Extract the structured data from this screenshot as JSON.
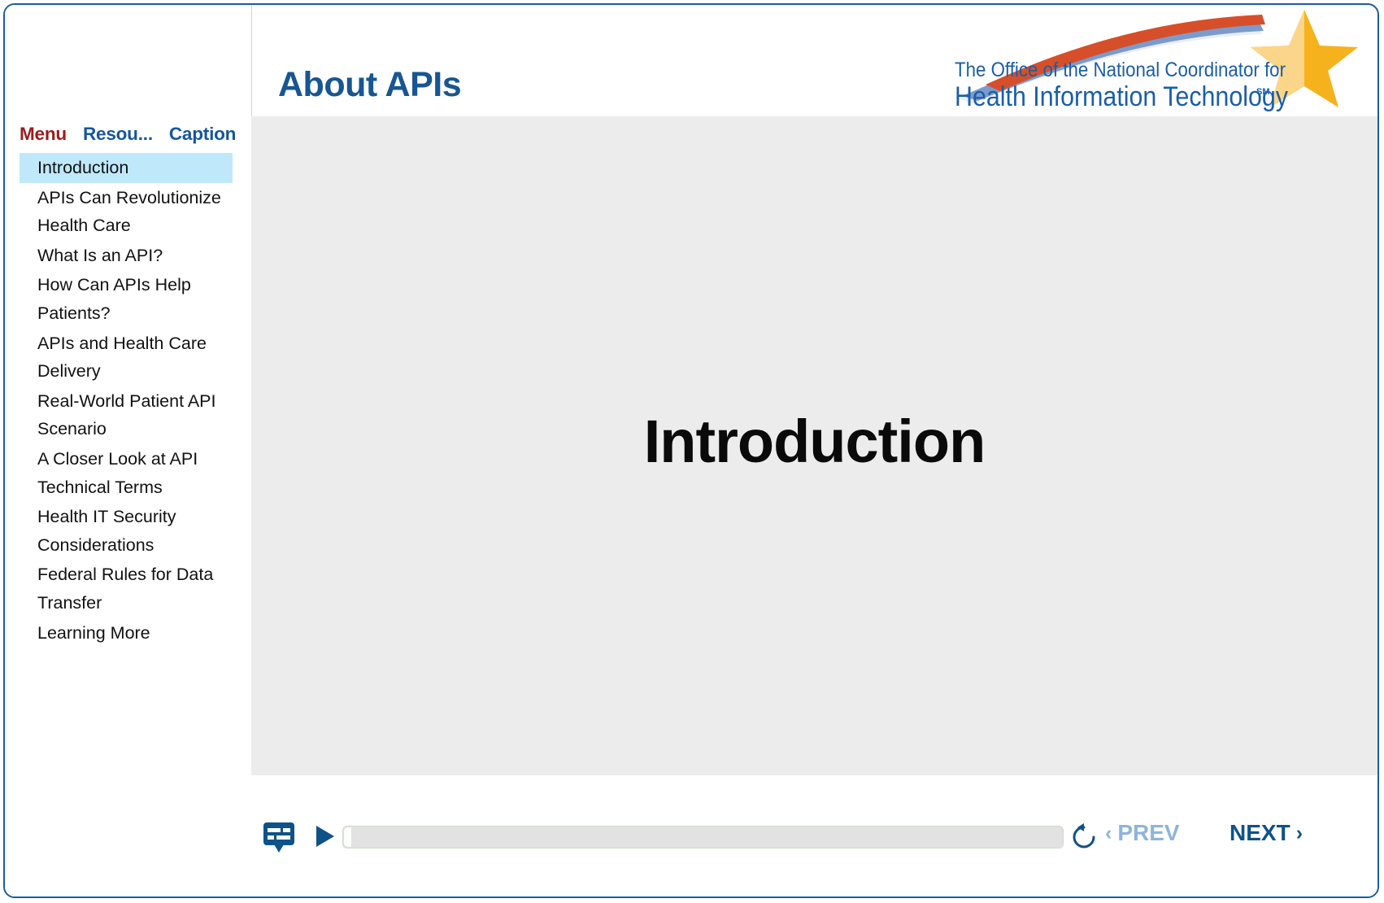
{
  "window": {
    "border_color": "#1a5e9a"
  },
  "header": {
    "title": "About APIs",
    "title_color": "#175693",
    "logo": {
      "name": "onc-logo",
      "line1": "The Office of the National Coordinator for",
      "line2": "Health Information Technology",
      "service_mark": "SM",
      "text_color": "#1b5ea8",
      "star_color": "#f5b21c",
      "star_highlight_color": "#fbd887",
      "swoosh_red": "#d94f2b",
      "swoosh_blue": "#6f8fc4",
      "swoosh_light": "#e8ecf5"
    }
  },
  "sidebar": {
    "tabs": [
      {
        "label": "Menu",
        "active": true
      },
      {
        "label": "Resou...",
        "active": false
      },
      {
        "label": "Caption",
        "active": false
      }
    ],
    "active_tab_color": "#9b1b1b",
    "inactive_tab_color": "#15569e",
    "selected_highlight_color": "#bfe9fb",
    "items": [
      {
        "label": "Introduction",
        "selected": true
      },
      {
        "label": "APIs Can Revolutionize Health Care",
        "selected": false
      },
      {
        "label": "What Is an API?",
        "selected": false
      },
      {
        "label": "How Can APIs Help Patients?",
        "selected": false
      },
      {
        "label": "APIs and Health Care Delivery",
        "selected": false
      },
      {
        "label": "Real-World Patient API Scenario",
        "selected": false
      },
      {
        "label": "A Closer Look at API Technical Terms",
        "selected": false
      },
      {
        "label": "Health IT Security Considerations",
        "selected": false
      },
      {
        "label": "Federal Rules for Data Transfer",
        "selected": false
      },
      {
        "label": "Learning More",
        "selected": false
      }
    ]
  },
  "slide": {
    "heading": "Introduction",
    "background_color": "#ececec"
  },
  "controls": {
    "cc_icon": "closed-caption-icon",
    "play_icon": "play-icon",
    "replay_icon": "replay-icon",
    "progress_percent": 0,
    "prev_label": "PREV",
    "prev_chevron": "‹",
    "prev_color": "#8fb4d9",
    "prev_enabled": false,
    "next_label": "NEXT",
    "next_chevron": "›",
    "next_color": "#0f5288",
    "next_enabled": true
  }
}
